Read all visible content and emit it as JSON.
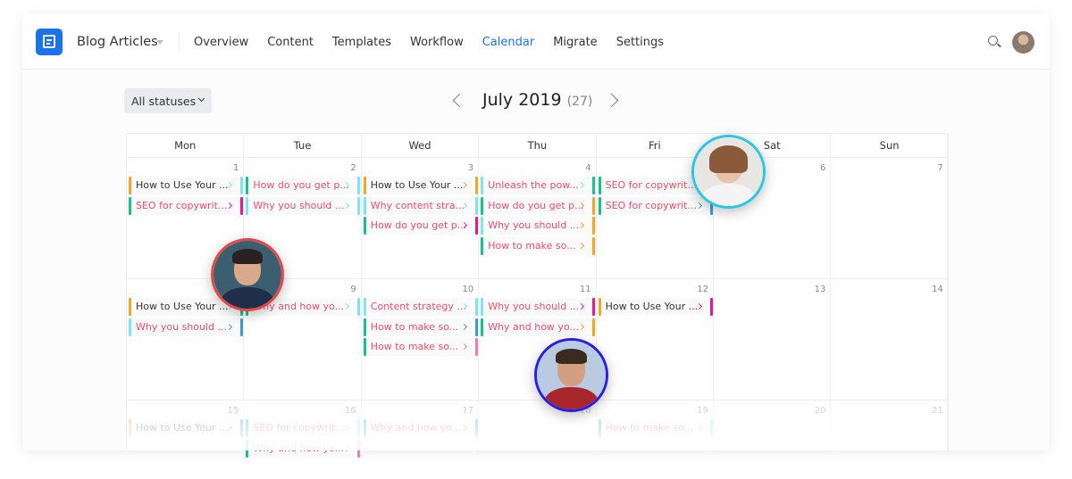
{
  "header": {
    "title": "Blog Articles",
    "nav": [
      "Overview",
      "Content",
      "Templates",
      "Workflow",
      "Calendar",
      "Migrate",
      "Settings"
    ],
    "active_nav": "Calendar",
    "icons": [
      "logo-icon",
      "search-icon",
      "avatar"
    ]
  },
  "toolbar": {
    "filter": "All statuses",
    "month": "July 2019",
    "count": "(27)"
  },
  "colors": {
    "orange": "#f5a623",
    "green": "#17c08c",
    "cyan": "#7fe6f0",
    "magenta": "#e8198b",
    "blue": "#3a9bd5",
    "pink": "#f27ab8",
    "red_text": "#ee4d6b",
    "dark_text": "#333333",
    "accent": "#1a73e8"
  },
  "weekdays": [
    "Mon",
    "Tue",
    "Wed",
    "Thu",
    "Fri",
    "Sat",
    "Sun"
  ],
  "weeks": [
    [
      {
        "day": "1",
        "cards": [
          [
            "orange",
            "How to Use Your ...",
            "dark",
            "cyan",
            "cyan"
          ],
          [
            "green",
            "SEO for copywrit...",
            "red",
            "magenta",
            "magenta"
          ]
        ]
      },
      {
        "day": "2",
        "cards": [
          [
            "green",
            "How do you get p...",
            "red",
            "cyan",
            "cyan"
          ],
          [
            "cyan",
            "Why you should ...",
            "red",
            "cyan",
            "cyan"
          ]
        ]
      },
      {
        "day": "3",
        "cards": [
          [
            "orange",
            "How to Use Your ...",
            "dark",
            "orange",
            "orange"
          ],
          [
            "cyan",
            "Why content stra...",
            "red",
            "cyan",
            "cyan"
          ],
          [
            "green",
            "How do you get p...",
            "red",
            "magenta",
            "magenta"
          ]
        ]
      },
      {
        "day": "4",
        "cards": [
          [
            "cyan",
            "Unleash the pow...",
            "red",
            "cyan",
            "green"
          ],
          [
            "green",
            "How do you get p...",
            "red",
            "orange",
            "orange"
          ],
          [
            "cyan",
            "Why you should ...",
            "red",
            "orange",
            "orange"
          ],
          [
            "green",
            "How to make so...",
            "red",
            "orange",
            "orange"
          ]
        ]
      },
      {
        "day": "5",
        "cards": [
          [
            "green",
            "SEO for copywrit...",
            "red",
            "cyan",
            "cyan"
          ],
          [
            "green",
            "SEO for copywrit...",
            "red",
            "blue",
            "blue"
          ]
        ]
      },
      {
        "day": "6",
        "cards": []
      },
      {
        "day": "7",
        "cards": []
      }
    ],
    [
      {
        "day": "8",
        "cards": [
          [
            "orange",
            "How to Use Your ...",
            "dark",
            "cyan",
            "green"
          ],
          [
            "cyan",
            "Why you should ...",
            "red",
            "blue",
            "blue"
          ]
        ]
      },
      {
        "day": "9",
        "cards": [
          [
            "green",
            "Why and how yo...",
            "red",
            "cyan",
            "cyan"
          ]
        ]
      },
      {
        "day": "10",
        "cards": [
          [
            "cyan",
            "Content strategy ...",
            "red",
            "cyan",
            "cyan"
          ],
          [
            "green",
            "How to make so...",
            "red",
            "blue",
            "blue"
          ],
          [
            "green",
            "How to make so...",
            "red",
            "pink",
            "pink"
          ]
        ]
      },
      {
        "day": "11",
        "cards": [
          [
            "cyan",
            "Why you should ...",
            "red",
            "magenta",
            "magenta"
          ],
          [
            "green",
            "Why and how yo...",
            "red",
            "orange",
            "orange"
          ]
        ]
      },
      {
        "day": "12",
        "cards": [
          [
            "orange",
            "How to Use Your ...",
            "dark",
            "magenta",
            "magenta"
          ]
        ]
      },
      {
        "day": "13",
        "cards": []
      },
      {
        "day": "14",
        "cards": []
      }
    ],
    [
      {
        "day": "15",
        "cards": [
          [
            "orange",
            "How to Use Your ...",
            "dark",
            "blue",
            "blue"
          ]
        ]
      },
      {
        "day": "16",
        "cards": [
          [
            "green",
            "SEO for copywrit...",
            "red",
            "cyan",
            "cyan"
          ],
          [
            "green",
            "Why and how yo...",
            "red",
            "pink",
            "pink"
          ]
        ]
      },
      {
        "day": "17",
        "cards": [
          [
            "green",
            "Why and how yo...",
            "red",
            "blue",
            "blue"
          ]
        ]
      },
      {
        "day": "18",
        "cards": []
      },
      {
        "day": "19",
        "cards": [
          [
            "green",
            "How to make so...",
            "red",
            "cyan",
            "cyan"
          ]
        ]
      },
      {
        "day": "20",
        "cards": []
      },
      {
        "day": "21",
        "cards": []
      }
    ]
  ],
  "collaborators": [
    {
      "border": "#e84545"
    },
    {
      "border": "#2bc6e6"
    },
    {
      "border": "#2a1fe0"
    }
  ]
}
